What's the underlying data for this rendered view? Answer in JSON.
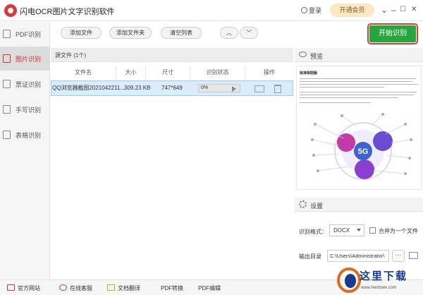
{
  "app": {
    "title": "闪电OCR图片文字识别软件"
  },
  "titlebar": {
    "login": "登录",
    "vip": "开通会员",
    "menu": "⌄",
    "minimize": "–",
    "maximize": "☐",
    "close": "✕"
  },
  "sidebar": {
    "items": [
      {
        "label": "PDF识别",
        "active": false
      },
      {
        "label": "图片识别",
        "active": true
      },
      {
        "label": "票证识别",
        "active": false
      },
      {
        "label": "手写识别",
        "active": false
      },
      {
        "label": "表格识别",
        "active": false
      }
    ]
  },
  "toolbar": {
    "add_file": "添加文件",
    "add_folder": "添加文件夹",
    "clear_list": "清空列表",
    "up": "︿",
    "down": "﹀",
    "start": "开始识别"
  },
  "file_list": {
    "title": "源文件 (1个)",
    "columns": [
      "文件名",
      "大小",
      "尺寸",
      "识别状态",
      "操作"
    ],
    "rows": [
      {
        "name": "QQ浏览器截图2021042211...",
        "size": "309.23 KB",
        "dimensions": "747*649",
        "progress_label": "0%",
        "progress": 0
      }
    ]
  },
  "preview": {
    "label": "预览",
    "doc_title": "标准规则版",
    "diagram_center": "5G"
  },
  "settings": {
    "label": "设置",
    "format_label": "识别格式：",
    "format_value": "DOCX",
    "merge_label": "合并为一个文件",
    "output_label": "输出目录",
    "output_path": "C:\\Users\\Administrator\\",
    "browse": "···"
  },
  "bottombar": {
    "items": [
      "官方网站",
      "在线客服",
      "文档翻译",
      "PDF转换",
      "PDF编辑"
    ]
  },
  "watermark": {
    "text": "这里下载",
    "url": "www.herdown.com"
  },
  "colors": {
    "accent_red": "#d6322e",
    "start_green": "#27a63f",
    "row_selected": "#d8ecfb"
  }
}
